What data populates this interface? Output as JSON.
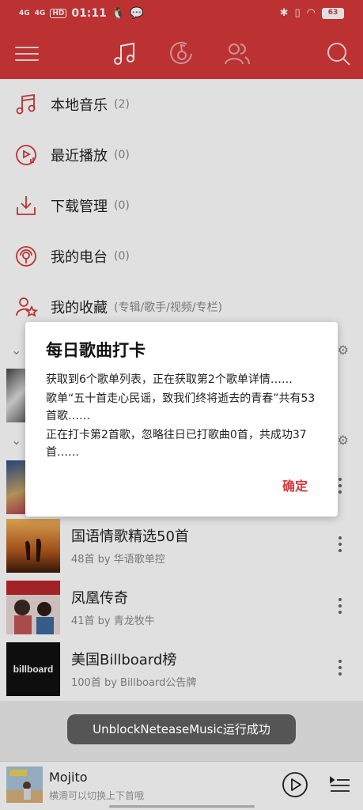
{
  "status_bar": {
    "signal1": "4G",
    "signal2": "4G",
    "hd": "HD",
    "time": "01:11",
    "battery": "63"
  },
  "nav": {
    "icons": [
      "menu-icon",
      "music-note-icon",
      "netease-logo-icon",
      "friends-icon",
      "search-icon"
    ]
  },
  "menu": [
    {
      "label": "本地音乐",
      "count": "(2)",
      "icon": "music-note-icon"
    },
    {
      "label": "最近播放",
      "count": "(0)",
      "icon": "recent-play-icon"
    },
    {
      "label": "下载管理",
      "count": "(0)",
      "icon": "download-icon"
    },
    {
      "label": "我的电台",
      "count": "(0)",
      "icon": "radio-icon"
    },
    {
      "label": "我的收藏",
      "count": "(专辑/歌手/视频/专栏)",
      "icon": "collection-icon"
    }
  ],
  "playlists": [
    {
      "title": "国语情歌精选50首",
      "sub": "48首 by 华语歌单控"
    },
    {
      "title": "凤凰传奇",
      "sub": "41首 by 青龙牧牛"
    },
    {
      "title": "美国Billboard榜",
      "sub": "100首 by Billboard公告牌",
      "cover_text": "billboard"
    }
  ],
  "dialog": {
    "title": "每日歌曲打卡",
    "line1": "获取到6个歌单列表，正在获取第2个歌单详情……",
    "line2": "歌单“五十首走心民谣，致我们终将逝去的青春”共有53首歌……",
    "line3": "正在打卡第2首歌，忽略往日已打歌曲0首，共成功37首……",
    "ok": "确定"
  },
  "toast": "UnblockNeteaseMusic运行成功",
  "player": {
    "title": "Mojito",
    "sub": "横滑可以切换上下首哦"
  },
  "colors": {
    "brand": "#d6393b"
  }
}
